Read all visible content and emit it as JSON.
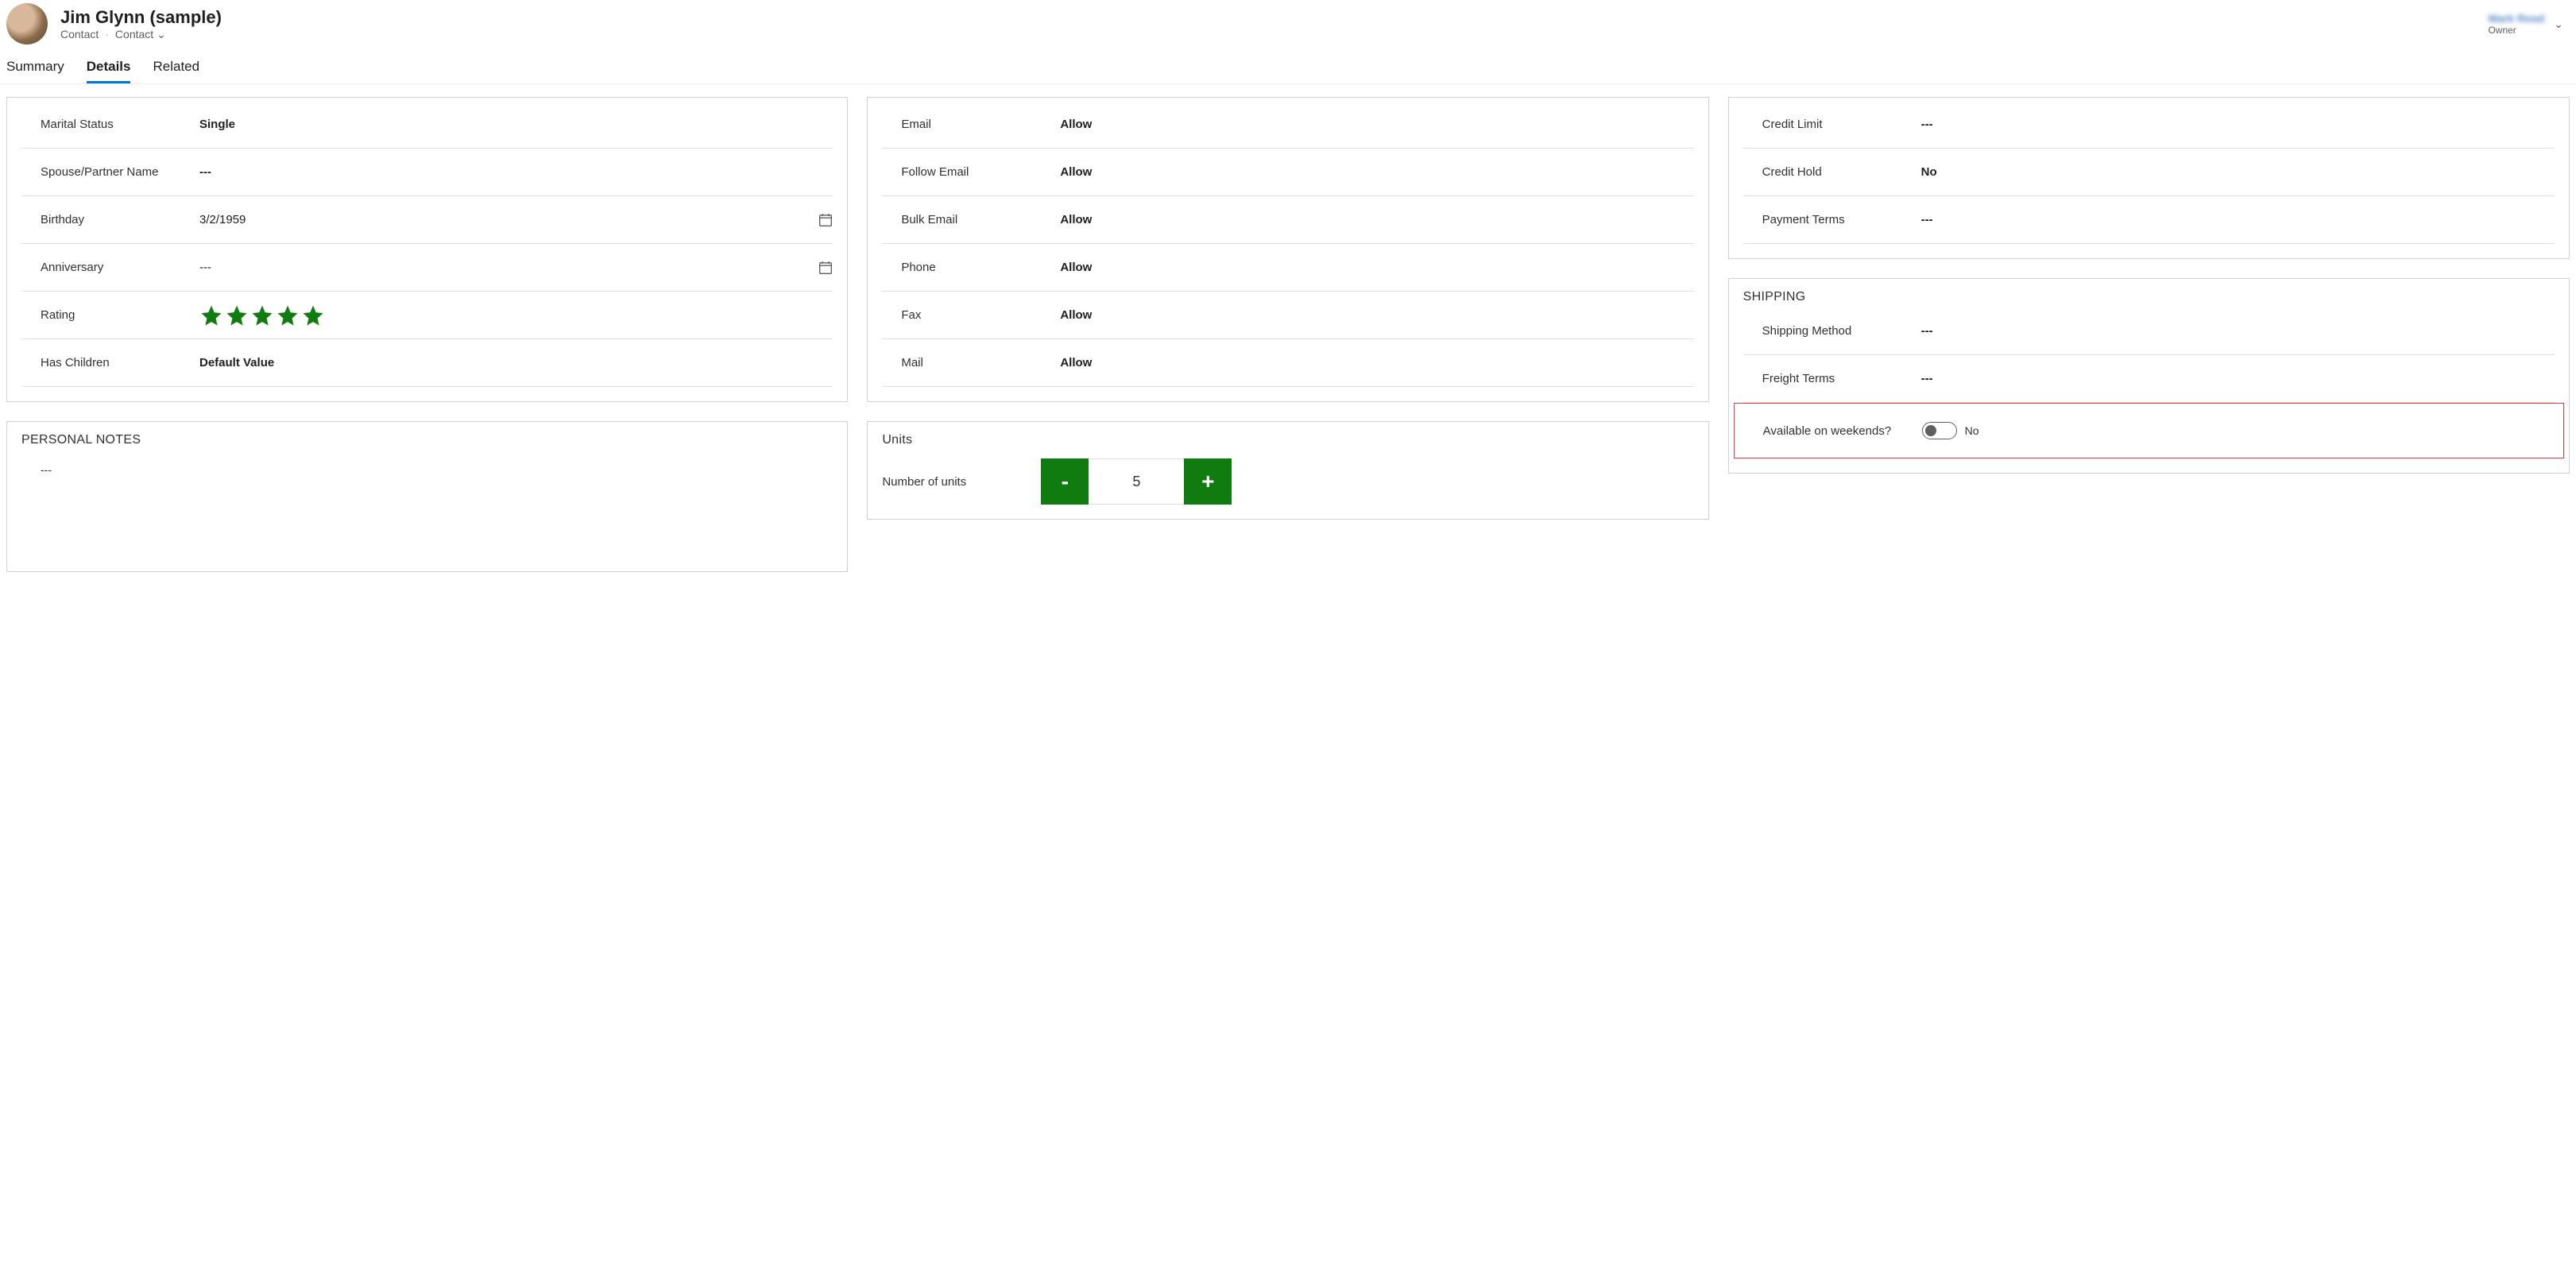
{
  "header": {
    "title": "Jim Glynn (sample)",
    "entity": "Contact",
    "form": "Contact",
    "owner_name": "Mark Read",
    "owner_label": "Owner"
  },
  "tabs": {
    "summary": "Summary",
    "details": "Details",
    "related": "Related"
  },
  "personal": {
    "marital_status_label": "Marital Status",
    "marital_status_value": "Single",
    "spouse_label": "Spouse/Partner Name",
    "spouse_value": "---",
    "birthday_label": "Birthday",
    "birthday_value": "3/2/1959",
    "anniversary_label": "Anniversary",
    "anniversary_value": "---",
    "rating_label": "Rating",
    "rating_value": 5,
    "has_children_label": "Has Children",
    "has_children_value": "Default Value"
  },
  "notes": {
    "title": "PERSONAL NOTES",
    "body": "---"
  },
  "contact_prefs": {
    "email_label": "Email",
    "email_value": "Allow",
    "follow_email_label": "Follow Email",
    "follow_email_value": "Allow",
    "bulk_email_label": "Bulk Email",
    "bulk_email_value": "Allow",
    "phone_label": "Phone",
    "phone_value": "Allow",
    "fax_label": "Fax",
    "fax_value": "Allow",
    "mail_label": "Mail",
    "mail_value": "Allow"
  },
  "units": {
    "title": "Units",
    "label": "Number of units",
    "value": "5",
    "minus": "-",
    "plus": "+"
  },
  "billing": {
    "credit_limit_label": "Credit Limit",
    "credit_limit_value": "---",
    "credit_hold_label": "Credit Hold",
    "credit_hold_value": "No",
    "payment_terms_label": "Payment Terms",
    "payment_terms_value": "---"
  },
  "shipping": {
    "title": "SHIPPING",
    "method_label": "Shipping Method",
    "method_value": "---",
    "freight_label": "Freight Terms",
    "freight_value": "---",
    "weekends_label": "Available on weekends?",
    "weekends_value": "No"
  }
}
